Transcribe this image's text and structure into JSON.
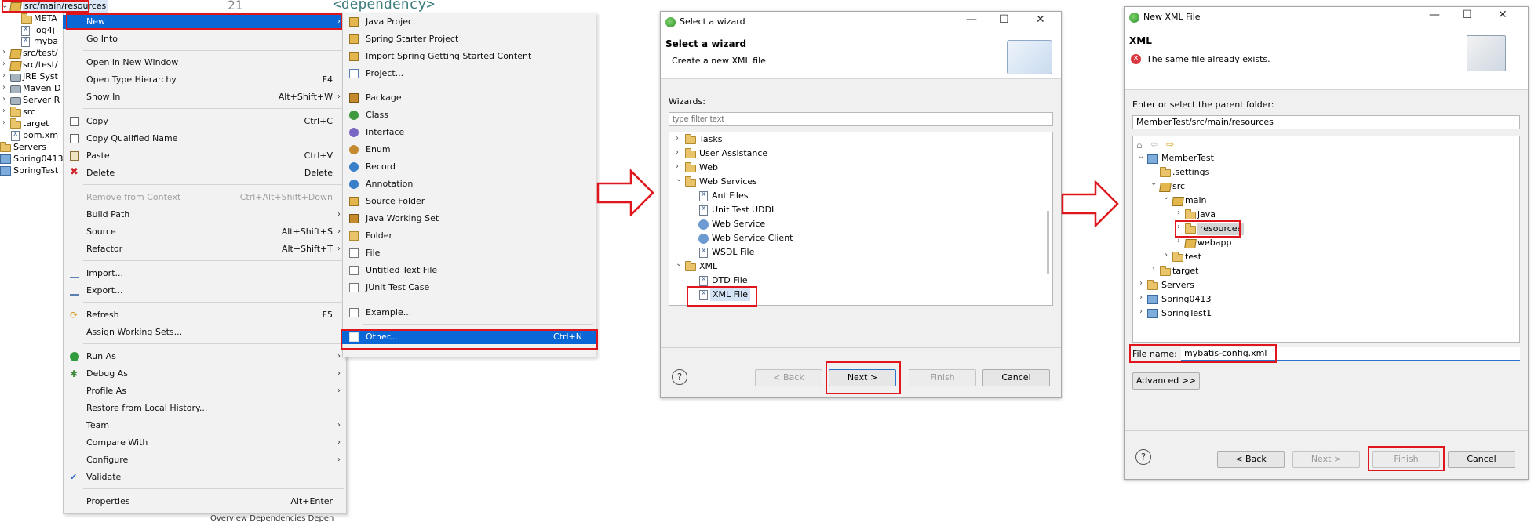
{
  "explorer": {
    "selected_item": "src/main/resources",
    "items": [
      "META",
      "log4j",
      "myba",
      "src/test/",
      "src/test/",
      "JRE Syst",
      "Maven D",
      "Server R",
      "src",
      "target",
      "pom.xm",
      "Servers",
      "Spring0413",
      "SpringTest"
    ]
  },
  "editor": {
    "line_number": "21",
    "line_text": "<dependency>",
    "bottom_tabs": "Overview  Dependencies  Depen"
  },
  "context_menu": {
    "items": [
      {
        "label": "New",
        "shortcut": "",
        "submenu": true
      },
      {
        "label": "Go Into",
        "shortcut": "",
        "submenu": false
      },
      {
        "label": "Open in New Window",
        "shortcut": "",
        "submenu": false
      },
      {
        "label": "Open Type Hierarchy",
        "shortcut": "F4",
        "submenu": false
      },
      {
        "label": "Show In",
        "shortcut": "Alt+Shift+W",
        "submenu": true
      },
      {
        "label": "Copy",
        "shortcut": "Ctrl+C",
        "submenu": false
      },
      {
        "label": "Copy Qualified Name",
        "shortcut": "",
        "submenu": false
      },
      {
        "label": "Paste",
        "shortcut": "Ctrl+V",
        "submenu": false
      },
      {
        "label": "Delete",
        "shortcut": "Delete",
        "submenu": false
      },
      {
        "label": "Remove from Context",
        "shortcut": "Ctrl+Alt+Shift+Down",
        "submenu": false
      },
      {
        "label": "Build Path",
        "shortcut": "",
        "submenu": true
      },
      {
        "label": "Source",
        "shortcut": "Alt+Shift+S",
        "submenu": true
      },
      {
        "label": "Refactor",
        "shortcut": "Alt+Shift+T",
        "submenu": true
      },
      {
        "label": "Import...",
        "shortcut": "",
        "submenu": false
      },
      {
        "label": "Export...",
        "shortcut": "",
        "submenu": false
      },
      {
        "label": "Refresh",
        "shortcut": "F5",
        "submenu": false
      },
      {
        "label": "Assign Working Sets...",
        "shortcut": "",
        "submenu": false
      },
      {
        "label": "Run As",
        "shortcut": "",
        "submenu": true
      },
      {
        "label": "Debug As",
        "shortcut": "",
        "submenu": true
      },
      {
        "label": "Profile As",
        "shortcut": "",
        "submenu": true
      },
      {
        "label": "Restore from Local History...",
        "shortcut": "",
        "submenu": false
      },
      {
        "label": "Team",
        "shortcut": "",
        "submenu": true
      },
      {
        "label": "Compare With",
        "shortcut": "",
        "submenu": true
      },
      {
        "label": "Configure",
        "shortcut": "",
        "submenu": true
      },
      {
        "label": "Validate",
        "shortcut": "",
        "submenu": false
      },
      {
        "label": "Properties",
        "shortcut": "Alt+Enter",
        "submenu": false
      }
    ]
  },
  "new_submenu": {
    "items": [
      {
        "label": "Java Project",
        "shortcut": ""
      },
      {
        "label": "Spring Starter Project",
        "shortcut": ""
      },
      {
        "label": "Import Spring Getting Started Content",
        "shortcut": ""
      },
      {
        "label": "Project...",
        "shortcut": ""
      },
      {
        "label": "Package",
        "shortcut": ""
      },
      {
        "label": "Class",
        "shortcut": ""
      },
      {
        "label": "Interface",
        "shortcut": ""
      },
      {
        "label": "Enum",
        "shortcut": ""
      },
      {
        "label": "Record",
        "shortcut": ""
      },
      {
        "label": "Annotation",
        "shortcut": ""
      },
      {
        "label": "Source Folder",
        "shortcut": ""
      },
      {
        "label": "Java Working Set",
        "shortcut": ""
      },
      {
        "label": "Folder",
        "shortcut": ""
      },
      {
        "label": "File",
        "shortcut": ""
      },
      {
        "label": "Untitled Text File",
        "shortcut": ""
      },
      {
        "label": "JUnit Test Case",
        "shortcut": ""
      },
      {
        "label": "Example...",
        "shortcut": ""
      },
      {
        "label": "Other...",
        "shortcut": "Ctrl+N"
      }
    ]
  },
  "wizard_dialog": {
    "title": "Select a wizard",
    "heading": "Select a wizard",
    "description": "Create a new XML file",
    "wizards_label": "Wizards:",
    "filter_placeholder": "type filter text",
    "tree": [
      {
        "label": "Tasks",
        "level": 0
      },
      {
        "label": "User Assistance",
        "level": 0
      },
      {
        "label": "Web",
        "level": 0
      },
      {
        "label": "Web Services",
        "level": 0
      },
      {
        "label": "Ant Files",
        "level": 1
      },
      {
        "label": "Unit Test UDDI",
        "level": 1
      },
      {
        "label": "Web Service",
        "level": 1
      },
      {
        "label": "Web Service Client",
        "level": 1
      },
      {
        "label": "WSDL File",
        "level": 1
      },
      {
        "label": "XML",
        "level": 0
      },
      {
        "label": "DTD File",
        "level": 1
      },
      {
        "label": "XML File",
        "level": 1
      }
    ],
    "buttons": {
      "back": "< Back",
      "next": "Next >",
      "finish": "Finish",
      "cancel": "Cancel"
    }
  },
  "xml_dialog": {
    "title": "New XML File",
    "heading": "XML",
    "error": "The same file already exists.",
    "parent_label": "Enter or select the parent folder:",
    "parent_value": "MemberTest/src/main/resources",
    "tree": [
      {
        "label": "MemberTest"
      },
      {
        "label": ".settings"
      },
      {
        "label": "src"
      },
      {
        "label": "main"
      },
      {
        "label": "java"
      },
      {
        "label": "resources"
      },
      {
        "label": "webapp"
      },
      {
        "label": "test"
      },
      {
        "label": "target"
      },
      {
        "label": "Servers"
      },
      {
        "label": "Spring0413"
      },
      {
        "label": "SpringTest1"
      }
    ],
    "file_name_label": "File name:",
    "file_name_value": "mybatis-config.xml",
    "advanced": "Advanced >>",
    "buttons": {
      "back": "< Back",
      "next": "Next >",
      "finish": "Finish",
      "cancel": "Cancel"
    }
  },
  "colors": {
    "highlight": "#0b67d6",
    "annotation": "#e0161d",
    "error": "#d9363e"
  }
}
